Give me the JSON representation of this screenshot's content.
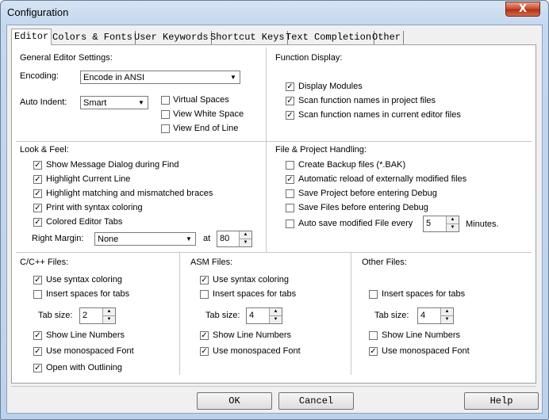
{
  "window": {
    "title": "Configuration",
    "close_glyph": "X"
  },
  "tabs": [
    {
      "label": "Editor"
    },
    {
      "label": "Colors & Fonts"
    },
    {
      "label": "User Keywords"
    },
    {
      "label": "Shortcut Keys"
    },
    {
      "label": "Text Completion"
    },
    {
      "label": "Other"
    }
  ],
  "general": {
    "heading": "General Editor Settings:",
    "encoding_label": "Encoding:",
    "encoding_value": "Encode in ANSI",
    "auto_indent_label": "Auto Indent:",
    "auto_indent_value": "Smart",
    "virtual_spaces": {
      "label": "Virtual Spaces",
      "checked": false
    },
    "view_white_space": {
      "label": "View White Space",
      "checked": false
    },
    "view_end_of_line": {
      "label": "View End of Line",
      "checked": false
    }
  },
  "function_display": {
    "heading": "Function Display:",
    "items": [
      {
        "label": "Display Modules",
        "checked": true
      },
      {
        "label": "Scan function names in project files",
        "checked": true
      },
      {
        "label": "Scan function names in current editor files",
        "checked": true
      }
    ]
  },
  "look_feel": {
    "heading": "Look & Feel:",
    "items": [
      {
        "label": "Show Message Dialog during Find",
        "checked": true
      },
      {
        "label": "Highlight Current Line",
        "checked": true
      },
      {
        "label": "Highlight matching and mismatched braces",
        "checked": true
      },
      {
        "label": "Print with syntax coloring",
        "checked": true
      },
      {
        "label": "Colored Editor Tabs",
        "checked": true
      }
    ],
    "right_margin_label": "Right Margin:",
    "right_margin_value": "None",
    "at_label": "at",
    "at_value": "80"
  },
  "file_project": {
    "heading": "File & Project Handling:",
    "items": [
      {
        "label": "Create Backup files (*.BAK)",
        "checked": false
      },
      {
        "label": "Automatic reload of externally modified files",
        "checked": true
      },
      {
        "label": "Save Project before entering Debug",
        "checked": false
      },
      {
        "label": "Save Files before entering Debug",
        "checked": false
      }
    ],
    "auto_save": {
      "label": "Auto save modified File every",
      "checked": false,
      "value": "5",
      "unit": "Minutes."
    }
  },
  "cpp_files": {
    "heading": "C/C++ Files:",
    "use_syntax_coloring": {
      "label": "Use syntax coloring",
      "checked": true
    },
    "insert_spaces": {
      "label": "Insert spaces for tabs",
      "checked": false
    },
    "tab_size_label": "Tab size:",
    "tab_size": "2",
    "show_line_numbers": {
      "label": "Show Line Numbers",
      "checked": true
    },
    "use_monospaced": {
      "label": "Use monospaced Font",
      "checked": true
    },
    "open_outlining": {
      "label": "Open with Outlining",
      "checked": true
    }
  },
  "asm_files": {
    "heading": "ASM Files:",
    "use_syntax_coloring": {
      "label": "Use syntax coloring",
      "checked": true
    },
    "insert_spaces": {
      "label": "Insert spaces for tabs",
      "checked": false
    },
    "tab_size_label": "Tab size:",
    "tab_size": "4",
    "show_line_numbers": {
      "label": "Show Line Numbers",
      "checked": true
    },
    "use_monospaced": {
      "label": "Use monospaced Font",
      "checked": true
    }
  },
  "other_files": {
    "heading": "Other Files:",
    "insert_spaces": {
      "label": "Insert spaces for tabs",
      "checked": false
    },
    "tab_size_label": "Tab size:",
    "tab_size": "4",
    "show_line_numbers": {
      "label": "Show Line Numbers",
      "checked": false
    },
    "use_monospaced": {
      "label": "Use monospaced Font",
      "checked": true
    }
  },
  "buttons": {
    "ok": "OK",
    "cancel": "Cancel",
    "help": "Help"
  },
  "glyphs": {
    "check": "✓",
    "arrow_down": "▼",
    "arrow_up": "▲"
  },
  "colors": {
    "title_gradient_top": "#d6e4f4",
    "close_red": "#c7472b",
    "dialog_bg": "#f0f0f0"
  }
}
